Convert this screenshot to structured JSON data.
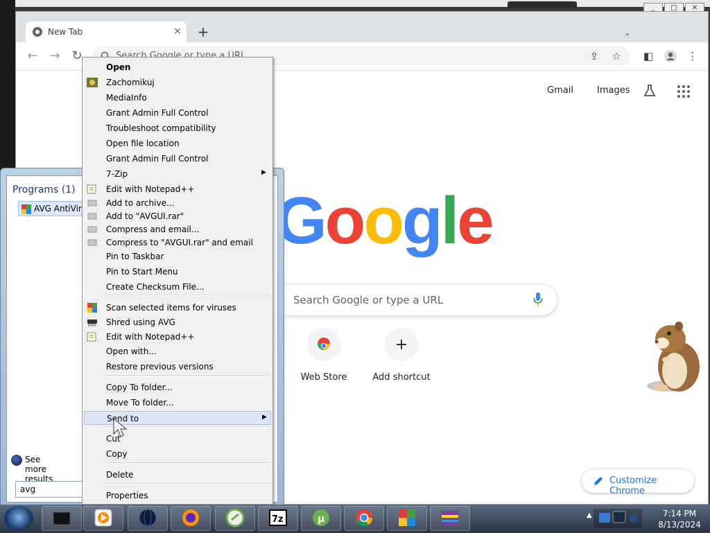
{
  "chrome": {
    "tab_title": "New Tab",
    "tab_close": "×",
    "new_tab": "+",
    "tab_search": "⌄",
    "omnibox_placeholder": "Search Google or type a URL",
    "ntp": {
      "gmail": "Gmail",
      "images": "Images",
      "logo_letters": [
        "G",
        "o",
        "o",
        "g",
        "l",
        "e"
      ],
      "logo_colors": [
        "#4285f4",
        "#ea4335",
        "#fbbc05",
        "#4285f4",
        "#34a853",
        "#ea4335"
      ],
      "search_placeholder": "Search Google or type a URL",
      "shortcuts": [
        {
          "label": "Web Store",
          "icon": "chrome-web-store-icon"
        },
        {
          "label": "Add shortcut",
          "icon": "plus-icon"
        }
      ],
      "customize": "Customize Chrome"
    }
  },
  "start_menu": {
    "programs_header": "Programs (1)",
    "program_item": "AVG AntiVirus",
    "see_more": "See more results",
    "search_value": "avg"
  },
  "context_menu": {
    "items": [
      {
        "label": "Open",
        "bold": true
      },
      {
        "label": "Zachomikuj",
        "icon": "zachomikuj-icon"
      },
      {
        "label": "MediaInfo"
      },
      {
        "label": "Grant Admin Full Control"
      },
      {
        "label": "Troubleshoot compatibility"
      },
      {
        "label": "Open file location"
      },
      {
        "label": "Grant Admin Full Control"
      },
      {
        "label": "7-Zip",
        "submenu": true
      },
      {
        "label": "Edit with Notepad++",
        "icon": "notepad-plus-plus-icon"
      },
      {
        "label": "Add to archive...",
        "icon": "winrar-icon"
      },
      {
        "label": "Add to \"AVGUI.rar\"",
        "icon": "winrar-icon"
      },
      {
        "label": "Compress and email...",
        "icon": "winrar-icon"
      },
      {
        "label": "Compress to \"AVGUI.rar\" and email",
        "icon": "winrar-icon"
      },
      {
        "label": "Pin to Taskbar"
      },
      {
        "label": "Pin to Start Menu"
      },
      {
        "label": "Create Checksum File..."
      },
      {
        "label": "Scan selected items for viruses",
        "icon": "avg-icon"
      },
      {
        "label": "Shred using AVG",
        "icon": "shredder-icon"
      },
      {
        "label": "Edit with Notepad++",
        "icon": "notepad-plus-plus-icon"
      },
      {
        "label": "Open with..."
      },
      {
        "label": "Restore previous versions"
      },
      {
        "label": "Copy To folder..."
      },
      {
        "label": "Move To folder..."
      },
      {
        "label": "Send to",
        "submenu": true,
        "highlighted": true
      },
      {
        "label": "Cut"
      },
      {
        "label": "Copy"
      },
      {
        "label": "Delete"
      },
      {
        "label": "Properties"
      }
    ]
  },
  "taskbar": {
    "apps": [
      "dark-app-icon",
      "media-player-icon",
      "globe-icon",
      "firefox-icon",
      "iconmaker-icon",
      "7zip-icon",
      "utorrent-icon",
      "chrome-icon",
      "avg-icon",
      "winrar-icon"
    ],
    "seven_zip_label": "7z",
    "time": "7:14 PM",
    "date": "8/13/2024"
  },
  "outer_window_controls": [
    "_",
    "□",
    "✕"
  ]
}
